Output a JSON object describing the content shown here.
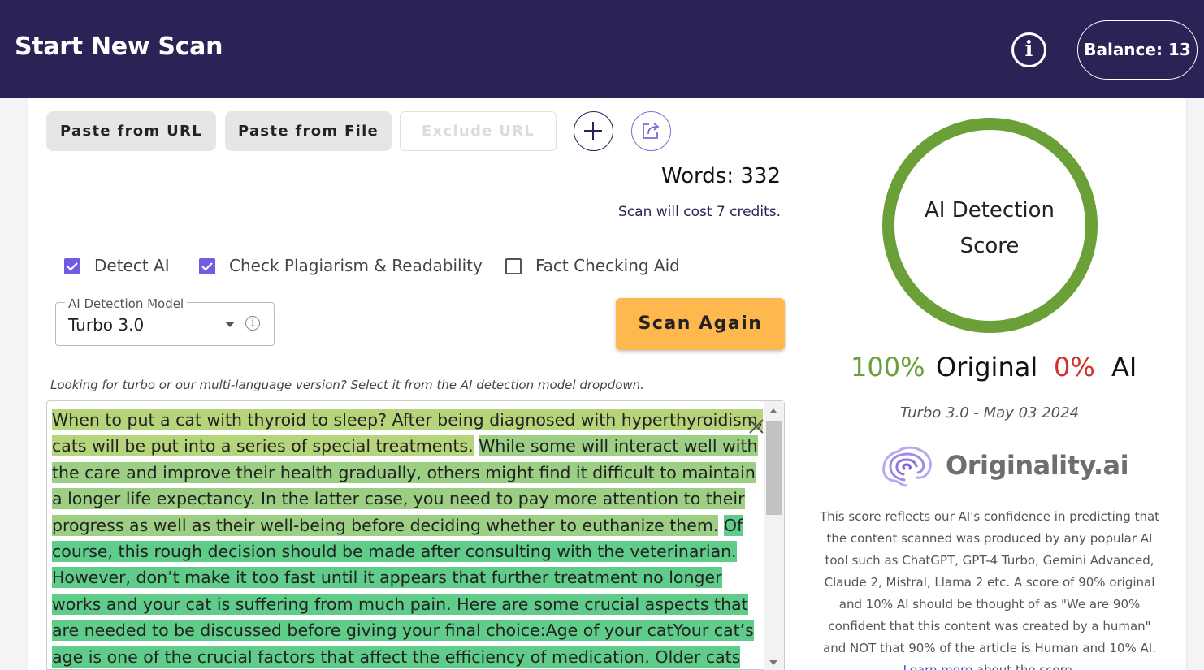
{
  "header": {
    "title": "Start New Scan",
    "info_icon": "info-circle-icon",
    "balance": "Balance: 13"
  },
  "toolbar": {
    "paste_url": "Paste from URL",
    "paste_file": "Paste from File",
    "exclude_url_placeholder": "Exclude URL",
    "add_icon": "plus-circle-icon",
    "export_icon": "share-export-icon"
  },
  "stats": {
    "words": "Words: 332",
    "cost": "Scan will cost 7 credits."
  },
  "options": [
    {
      "label": "Detect AI",
      "checked": true
    },
    {
      "label": "Check Plagiarism & Readability",
      "checked": true
    },
    {
      "label": "Fact Checking Aid",
      "checked": false
    }
  ],
  "model_select": {
    "legend": "AI Detection Model",
    "value": "Turbo 3.0"
  },
  "scan_button": "Scan Again",
  "hint": "Looking for turbo or our multi-language version? Select it from the AI detection model dropdown.",
  "content": {
    "segments": [
      {
        "text": "When to put a cat with thyroid to sleep? After being diagnosed with hyperthyroidism, cats will be put into a series of special treatments.",
        "highlight": "hl1"
      },
      {
        "text": " ",
        "highlight": ""
      },
      {
        "text": "While some will interact well with the care and improve their health gradually, others might find it difficult to maintain a longer life expectancy. In the latter case, you need to pay more attention to their progress as well as their well-being before deciding whether to euthanize them.",
        "highlight": "hl2"
      },
      {
        "text": " ",
        "highlight": ""
      },
      {
        "text": "Of course, this rough decision should be made after consulting with the veterinarian. However, don’t make it too fast until it appears that further treatment no longer works and your cat is suffering from much pain. Here are some crucial aspects that are needed to be discussed before giving your final choice:Age of your catYour cat’s age is one of the crucial factors that affect the efficiency of medication. Older cats with thyroid stand a less chance of surviving, compared to the",
        "highlight": "hl3"
      }
    ]
  },
  "result": {
    "gauge_title": "AI Detection Score",
    "original_pct": "100%",
    "original_label": "Original",
    "ai_pct": "0%",
    "ai_label": "AI",
    "original_fraction": 1.0,
    "model_date": "Turbo 3.0 - May 03 2024",
    "brand": "Originality.ai",
    "explanation": "This score reflects our AI's confidence in predicting that the content scanned was produced by any popular AI tool such as ChatGPT, GPT-4 Turbo, Gemini Advanced, Claude 2, Mistral, Llama 2 etc. A score of 90% original and 10% AI should be thought of as \"We are 90% confident that this content was created by a human\" and NOT that 90% of the article is Human and 10% AI.",
    "learn_more": "Learn more",
    "learn_more_tail": " about the score."
  },
  "colors": {
    "header_bg": "#2a2356",
    "accent_purple": "#6f5ce0",
    "scan_button": "#ffb84e",
    "original_green": "#6aa037",
    "ai_red": "#d0302e"
  }
}
